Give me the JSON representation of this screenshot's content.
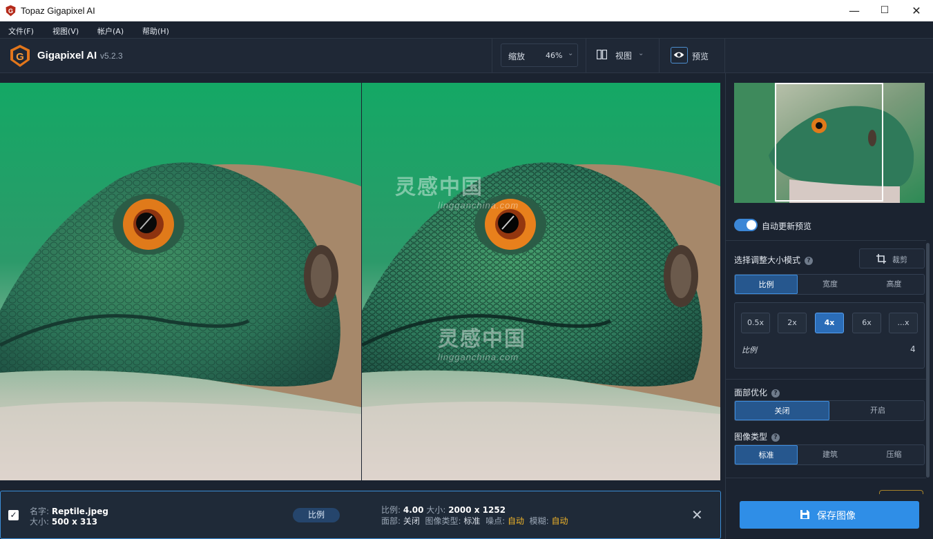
{
  "window": {
    "title": "Topaz Gigapixel AI",
    "minimize": "—",
    "maximize": "☐",
    "close": "✕"
  },
  "menu": [
    {
      "label": "文件(F)"
    },
    {
      "label": "视图(V)"
    },
    {
      "label": "帐户(A)"
    },
    {
      "label": "帮助(H)"
    }
  ],
  "header": {
    "app_name": "Gigapixel AI",
    "version": "v5.2.3",
    "zoom_label": "缩放",
    "zoom_value": "46%",
    "view_label": "视图",
    "preview_label": "预览"
  },
  "watermark": {
    "text": "灵感中国",
    "url": "lingganchina.com"
  },
  "panel": {
    "auto_update_label": "自动更新预览",
    "auto_update_on": true,
    "resize_mode_label": "选择调整大小模式",
    "crop_label": "裁剪",
    "resize_tabs": [
      {
        "label": "比例",
        "active": true
      },
      {
        "label": "宽度",
        "active": false
      },
      {
        "label": "高度",
        "active": false
      }
    ],
    "scales": [
      {
        "label": "0.5x",
        "active": false
      },
      {
        "label": "2x",
        "active": false
      },
      {
        "label": "4x",
        "active": true
      },
      {
        "label": "6x",
        "active": false
      },
      {
        "label": "...x",
        "active": false
      }
    ],
    "scale_field_label": "比例",
    "scale_value": "4",
    "face_label": "面部优化",
    "face_tabs": [
      {
        "label": "关闭",
        "active": true
      },
      {
        "label": "开启",
        "active": false
      }
    ],
    "image_type_label": "图像类型",
    "image_type_tabs": [
      {
        "label": "标准",
        "active": true
      },
      {
        "label": "建筑",
        "active": false
      },
      {
        "label": "压缩",
        "active": false
      }
    ],
    "save_label": "保存图像"
  },
  "file": {
    "checked": true,
    "name_label": "名字:",
    "name": "Reptile.jpeg",
    "size_label": "大小:",
    "size": "500 x 313",
    "mode_badge": "比例",
    "ratio_label": "比例:",
    "ratio": "4.00",
    "out_size_label": "大小:",
    "out_size": "2000 x 1252",
    "face_label": "面部:",
    "face": "关闭",
    "type_label": "图像类型:",
    "type": "标准",
    "noise_label": "噪点:",
    "noise": "自动",
    "blur_label": "模糊:",
    "blur": "自动"
  },
  "colors": {
    "accent": "#2f8ee7",
    "active_segment": "#26578e",
    "auto_value": "#f0b429",
    "background": "#1b2330"
  }
}
